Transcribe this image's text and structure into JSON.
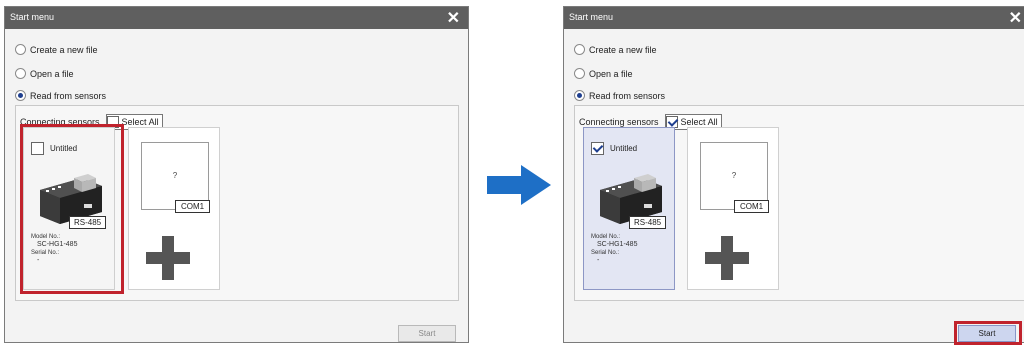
{
  "left_window": {
    "title": "Start menu",
    "close": "✕",
    "options": {
      "create": "Create a new file",
      "open": "Open a file",
      "read": "Read from sensors"
    },
    "connecting_sensors": "Connecting sensors",
    "select_all": "Select All",
    "select_all_checked": false,
    "sensor": {
      "name": "Untitled",
      "checked": false,
      "interface": "RS-485",
      "model_label": "Model No.:",
      "model_value": "SC-HG1-485",
      "serial_label": "Serial No.:",
      "serial_value": "-"
    },
    "unknown_card": {
      "question": "?",
      "port": "COM1"
    },
    "start": "Start",
    "start_enabled": false
  },
  "right_window": {
    "title": "Start menu",
    "close": "✕",
    "options": {
      "create": "Create a new file",
      "open": "Open a file",
      "read": "Read from sensors"
    },
    "connecting_sensors": "Connecting sensors",
    "select_all": "Select All",
    "select_all_checked": true,
    "sensor": {
      "name": "Untitled",
      "checked": true,
      "interface": "RS-485",
      "model_label": "Model No.:",
      "model_value": "SC-HG1-485",
      "serial_label": "Serial No.:",
      "serial_value": "-"
    },
    "unknown_card": {
      "question": "?",
      "port": "COM1"
    },
    "start": "Start",
    "start_enabled": true
  },
  "colors": {
    "titlebar": "#5f5f5f",
    "highlight": "#c0232d",
    "arrow": "#1e6fc6",
    "selected_card": "#e3e6f3"
  },
  "icons": [
    "close-icon",
    "sensor-device-icon",
    "plus-icon",
    "right-arrow-icon"
  ]
}
